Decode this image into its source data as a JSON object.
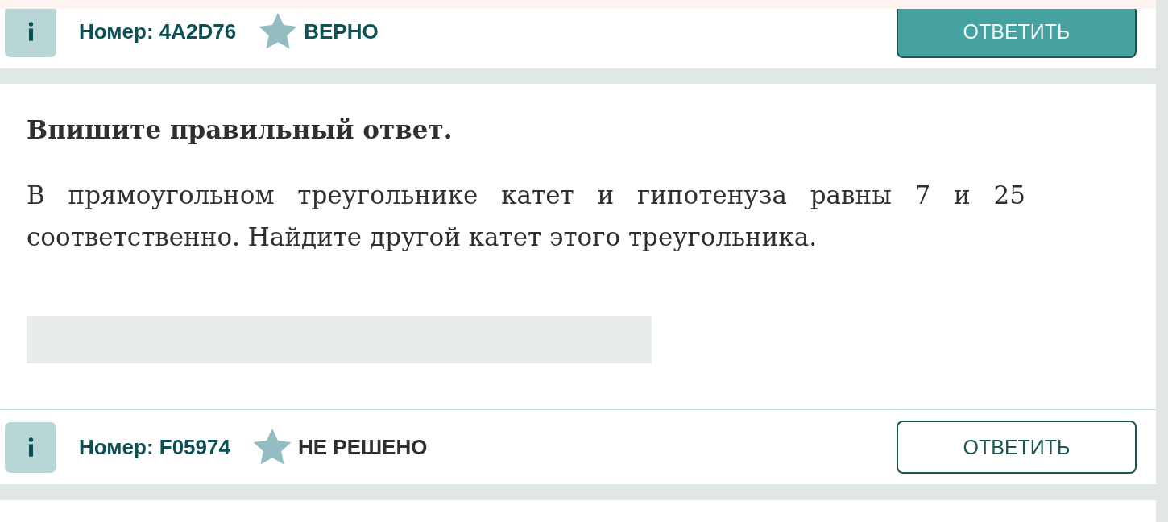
{
  "tasks": [
    {
      "footer": {
        "number": "Номер: 4A2D76",
        "status": {
          "kind": "correct",
          "text": "ВЕРНО"
        },
        "answer_button": {
          "label": "ОТВЕТИТЬ",
          "filled": true
        }
      }
    },
    {
      "instruction": "Впишите правильный ответ.",
      "question": "В прямоугольном треугольнике катет и гипотенуза равны 7 и 25 соответственно. Найдите другой катет этого треугольника.",
      "footer": {
        "number": "Номер: F05974",
        "status": {
          "kind": "unsolved",
          "text": "НЕ РЕШЕНО"
        },
        "answer_button": {
          "label": "ОТВЕТИТЬ",
          "filled": false
        }
      }
    }
  ]
}
